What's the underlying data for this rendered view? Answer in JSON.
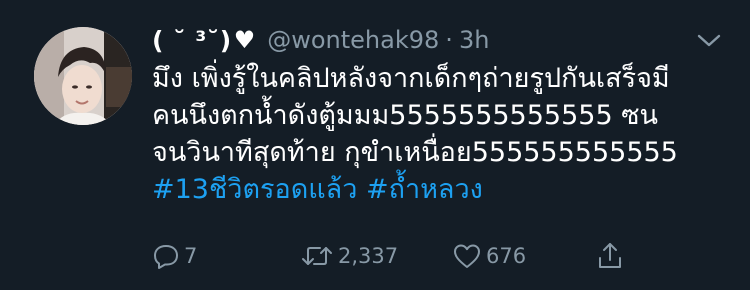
{
  "tweet": {
    "display_name": "( ˘ ³˘)",
    "name_emoji": "heart-suit-icon",
    "handle": "@wontehak98",
    "separator": "·",
    "time": "3h",
    "lines": [
      "มึง เพิ่งรู้ในคลิปหลังจากเด็กๆถ่ายรูปกันเสร็จมี",
      "คนนึงตกน้ำดังตู้มมม5555555555555 ซน",
      "จนวินาทีสุดท้าย กุขำเหนื่อย555555555555"
    ],
    "hashtags": [
      "#13ชีวิตรอดแล้ว",
      "#ถ้ำหลวง"
    ],
    "actions": {
      "reply_count": "7",
      "retweet_count": "2,337",
      "like_count": "676"
    }
  },
  "colors": {
    "background": "#141d26",
    "text": "#ffffff",
    "muted": "#8899a6",
    "link": "#1da1f2"
  }
}
